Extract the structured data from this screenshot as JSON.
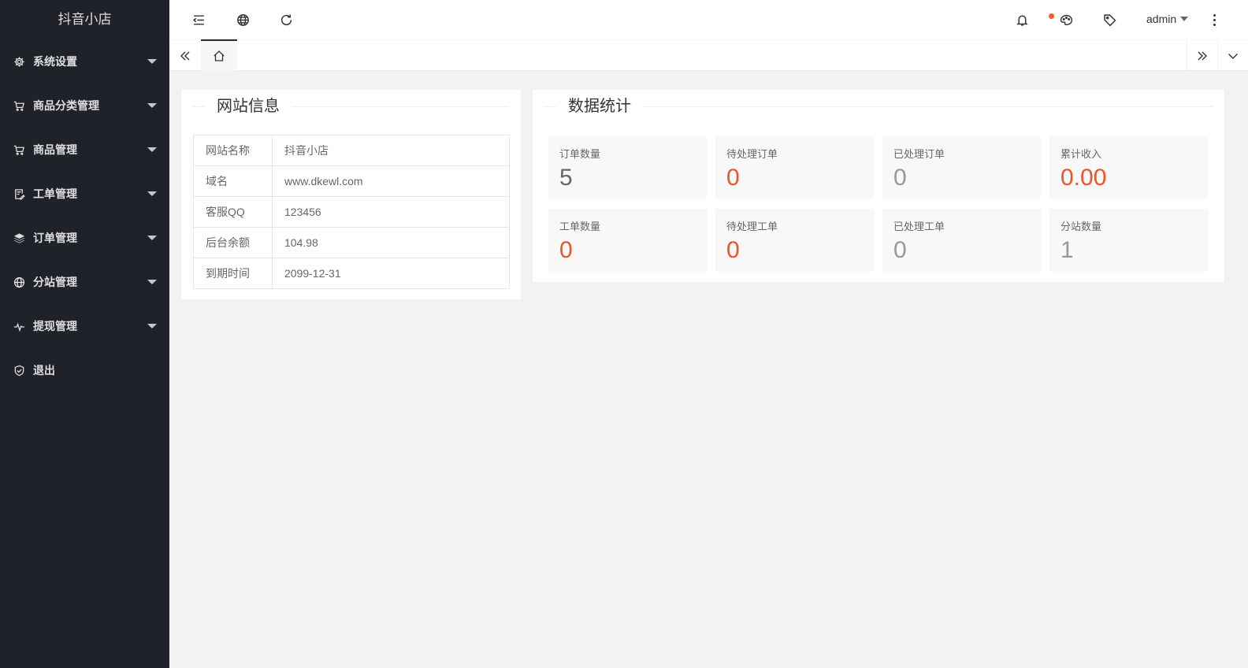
{
  "sidebar": {
    "logo": "抖音小店",
    "items": [
      {
        "label": "系统设置",
        "icon": "gear-icon",
        "expandable": true
      },
      {
        "label": "商品分类管理",
        "icon": "cart-icon",
        "expandable": true
      },
      {
        "label": "商品管理",
        "icon": "cart-icon",
        "expandable": true
      },
      {
        "label": "工单管理",
        "icon": "ticket-edit-icon",
        "expandable": true
      },
      {
        "label": "订单管理",
        "icon": "layers-icon",
        "expandable": true
      },
      {
        "label": "分站管理",
        "icon": "globe-icon",
        "expandable": true
      },
      {
        "label": "提现管理",
        "icon": "pulse-icon",
        "expandable": true
      },
      {
        "label": "退出",
        "icon": "shield-check-icon",
        "expandable": false
      }
    ]
  },
  "header": {
    "user": "admin",
    "notify_dot_color": "#ff5722"
  },
  "site_info": {
    "title": "网站信息",
    "rows": [
      {
        "key": "网站名称",
        "value": "抖音小店"
      },
      {
        "key": "域名",
        "value": "www.dkewl.com"
      },
      {
        "key": "客服QQ",
        "value": "123456"
      },
      {
        "key": "后台余额",
        "value": "104.98"
      },
      {
        "key": "到期时间",
        "value": "2099-12-31"
      }
    ]
  },
  "stats": {
    "title": "数据统计",
    "items": [
      {
        "label": "订单数量",
        "value": "5",
        "color": "#666666"
      },
      {
        "label": "待处理订单",
        "value": "0",
        "color": "#e8562a"
      },
      {
        "label": "已处理订单",
        "value": "0",
        "color": "#999999"
      },
      {
        "label": "累计收入",
        "value": "0.00",
        "color": "#e8562a"
      },
      {
        "label": "工单数量",
        "value": "0",
        "color": "#e8562a"
      },
      {
        "label": "待处理工单",
        "value": "0",
        "color": "#e8562a"
      },
      {
        "label": "已处理工单",
        "value": "0",
        "color": "#999999"
      },
      {
        "label": "分站数量",
        "value": "1",
        "color": "#999999"
      }
    ]
  }
}
